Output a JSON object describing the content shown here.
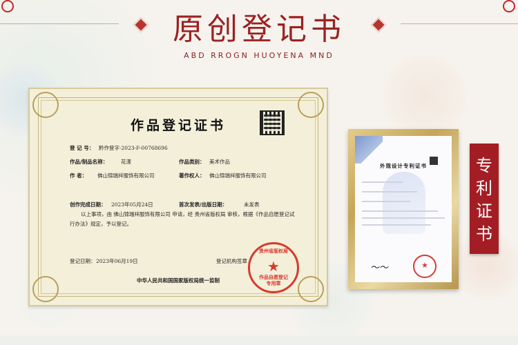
{
  "header": {
    "title": "原创登记书",
    "subtitle": "ABD RROGN HUOYENA MND"
  },
  "certificate": {
    "title": "作品登记证书",
    "reg_no_label": "登 记 号：",
    "reg_no_value": "黔作登字-2023-F-00768696",
    "work_name_label": "作品/制品名称：",
    "work_name_value": "花漾",
    "work_type_label": "作品类别：",
    "work_type_value": "美术作品",
    "author_label": "作      者：",
    "author_value": "佛山锦瑞祥服饰有限公司",
    "owner_label": "著作权人：",
    "owner_value": "佛山锦瑞祥服饰有限公司",
    "created_label": "创作完成日期：",
    "created_value": "2023年05月24日",
    "published_label": "首次发表/出版日期：",
    "published_value": "未发表",
    "body_line1": "以上事项，由   佛山锦瑞祥服饰有限公司   申请，经   贵州省版权局   审核，根据《作品自愿登记试",
    "body_line2": "行办法》规定，予以登记。",
    "reg_date_label": "登记日期：",
    "reg_date_value": "2023年06月19日",
    "org_label": "登记机构签章",
    "footer": "中华人民共和国国家版权局统一监制",
    "seal_top": "贵州省版权局",
    "seal_bottom": "作品自愿登记",
    "seal_bottom2": "专用章"
  },
  "patent": {
    "title": "外观设计专利证书"
  },
  "side_label": {
    "text": "专利证书"
  },
  "colors": {
    "accent_red": "#9b2222",
    "label_bg": "#a31e24",
    "gold_frame": "#c5a55a"
  }
}
